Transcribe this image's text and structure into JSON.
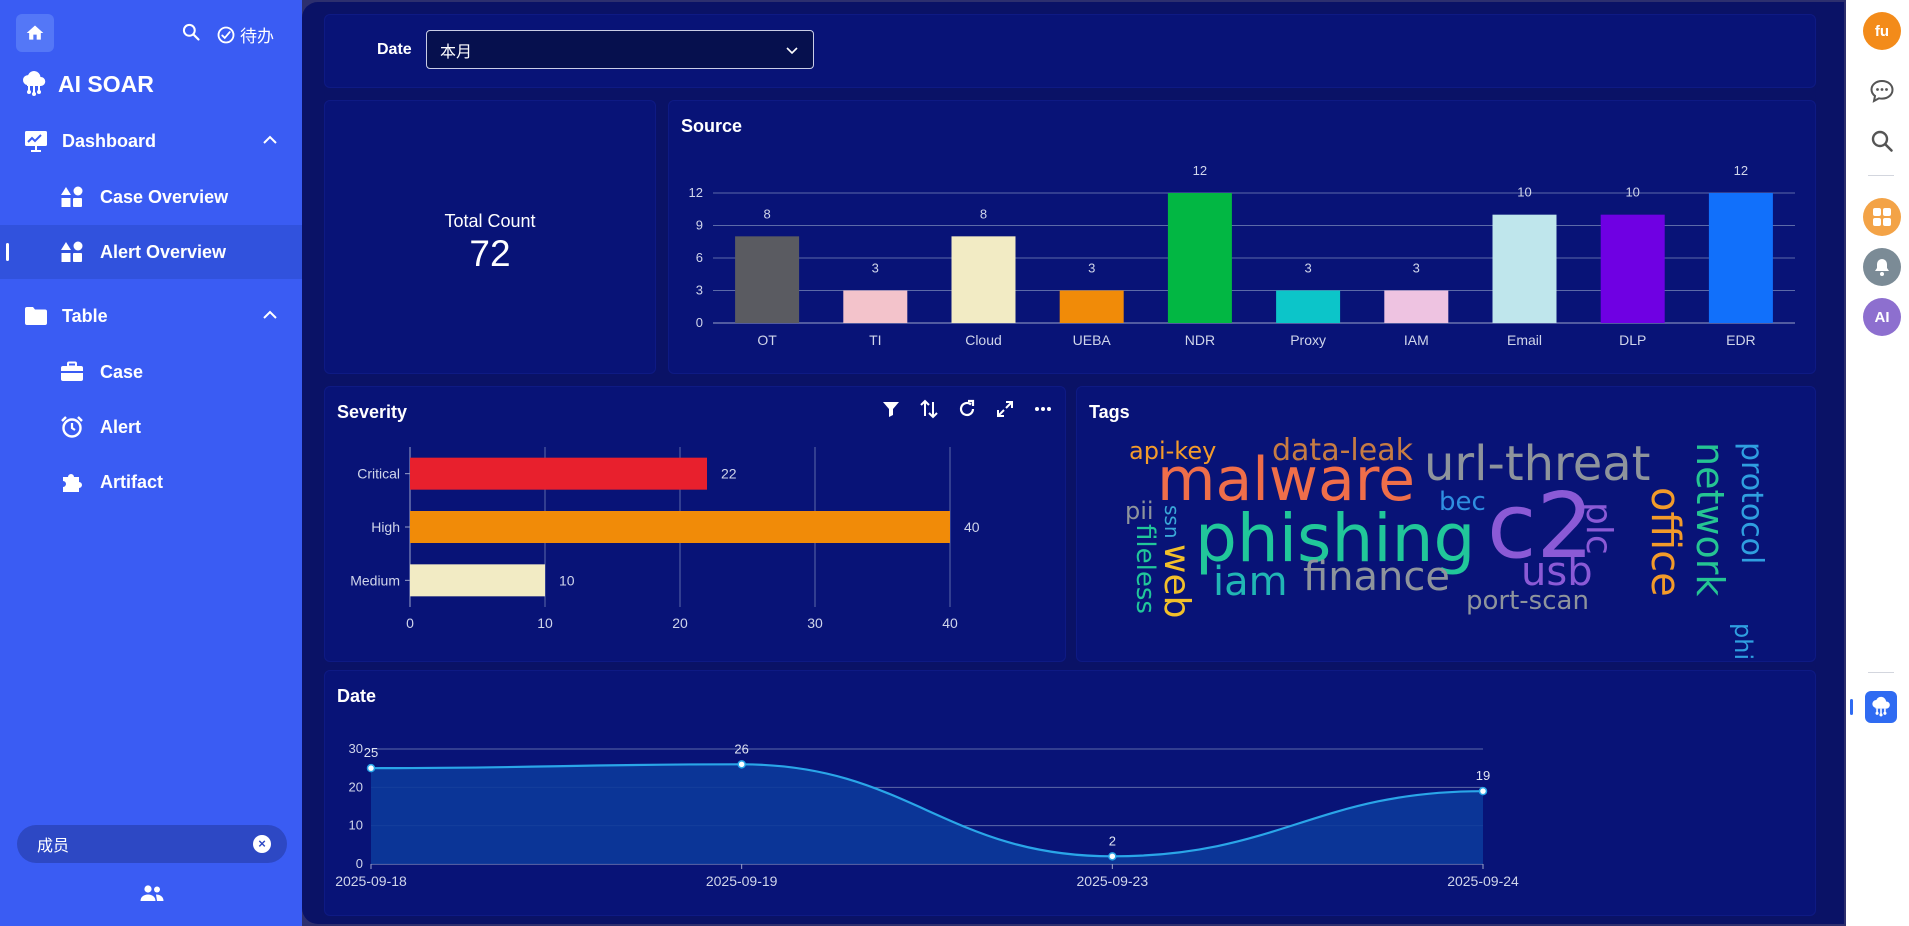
{
  "sidebar": {
    "todo_label": "待办",
    "brand": "AI SOAR",
    "groups": [
      {
        "label": "Dashboard",
        "items": [
          {
            "label": "Case Overview"
          },
          {
            "label": "Alert Overview",
            "active": true
          }
        ]
      },
      {
        "label": "Table",
        "items": [
          {
            "label": "Case"
          },
          {
            "label": "Alert"
          },
          {
            "label": "Artifact"
          }
        ]
      }
    ],
    "member_label": "成员"
  },
  "filter": {
    "label": "Date",
    "value": "本月"
  },
  "total": {
    "label": "Total Count",
    "value": "72"
  },
  "source": {
    "title": "Source"
  },
  "severity": {
    "title": "Severity"
  },
  "tags": {
    "title": "Tags"
  },
  "date_panel": {
    "title": "Date"
  },
  "rail": {
    "avatar": "fu",
    "ai_label": "AI"
  },
  "colors": {
    "sidebar": "#3a5cf3",
    "main_bg": "#0a1266",
    "card_bg": "#081377"
  },
  "chart_data": [
    {
      "id": "source",
      "type": "bar",
      "title": "Source",
      "categories": [
        "OT",
        "TI",
        "Cloud",
        "UEBA",
        "NDR",
        "Proxy",
        "IAM",
        "Email",
        "DLP",
        "EDR"
      ],
      "values": [
        8,
        3,
        8,
        3,
        12,
        3,
        3,
        10,
        10,
        12
      ],
      "colors": [
        "#5a5b61",
        "#f3c3cb",
        "#f2ebc4",
        "#f18b08",
        "#02b743",
        "#0cc5c9",
        "#eec3e1",
        "#bfe6ec",
        "#6f00e3",
        "#1170fb"
      ],
      "ylim": [
        0,
        12
      ],
      "yticks": [
        0,
        3,
        6,
        9,
        12
      ],
      "grid": true,
      "data_labels": true
    },
    {
      "id": "severity",
      "type": "bar",
      "orientation": "horizontal",
      "title": "Severity",
      "categories": [
        "Critical",
        "High",
        "Medium"
      ],
      "values": [
        22,
        40,
        10
      ],
      "colors": [
        "#e8202d",
        "#f18b08",
        "#f2ebc4"
      ],
      "xlim": [
        0,
        40
      ],
      "xticks": [
        0,
        10,
        20,
        30,
        40
      ],
      "grid": true,
      "data_labels": true
    },
    {
      "id": "tags",
      "type": "wordcloud",
      "title": "Tags",
      "words": [
        {
          "text": "api-key",
          "color": "#f39b2a"
        },
        {
          "text": "malware",
          "color": "#ef6e4a"
        },
        {
          "text": "data-leak",
          "color": "#c77c43"
        },
        {
          "text": "url-threat",
          "color": "#8e949c"
        },
        {
          "text": "network",
          "color": "#25c493"
        },
        {
          "text": "protocol",
          "color": "#2f9fe0"
        },
        {
          "text": "pii",
          "color": "#8e949c"
        },
        {
          "text": "bec",
          "color": "#2f8fe0"
        },
        {
          "text": "c2",
          "color": "#8b5ad6"
        },
        {
          "text": "plc",
          "color": "#8b5ad6"
        },
        {
          "text": "office",
          "color": "#f39b2a"
        },
        {
          "text": "ssn",
          "color": "#3aa7d8"
        },
        {
          "text": "phishing",
          "color": "#21c79a"
        },
        {
          "text": "fileless",
          "color": "#21c79a"
        },
        {
          "text": "web",
          "color": "#f2c02a"
        },
        {
          "text": "iam",
          "color": "#21b6b4"
        },
        {
          "text": "finance",
          "color": "#8e949c"
        },
        {
          "text": "usb",
          "color": "#8b5ad6"
        },
        {
          "text": "port-scan",
          "color": "#8e949c"
        },
        {
          "text": "phi",
          "color": "#2f9fe0"
        }
      ]
    },
    {
      "id": "date",
      "type": "area",
      "title": "Date",
      "x": [
        "2025-09-18",
        "2025-09-19",
        "2025-09-23",
        "2025-09-24"
      ],
      "values": [
        25,
        26,
        2,
        19
      ],
      "ylim": [
        0,
        30
      ],
      "yticks": [
        0,
        10,
        20,
        30
      ],
      "grid": true,
      "data_labels": true,
      "line_color": "#2aa6e8",
      "fill_color": "#0c3a9a"
    }
  ]
}
